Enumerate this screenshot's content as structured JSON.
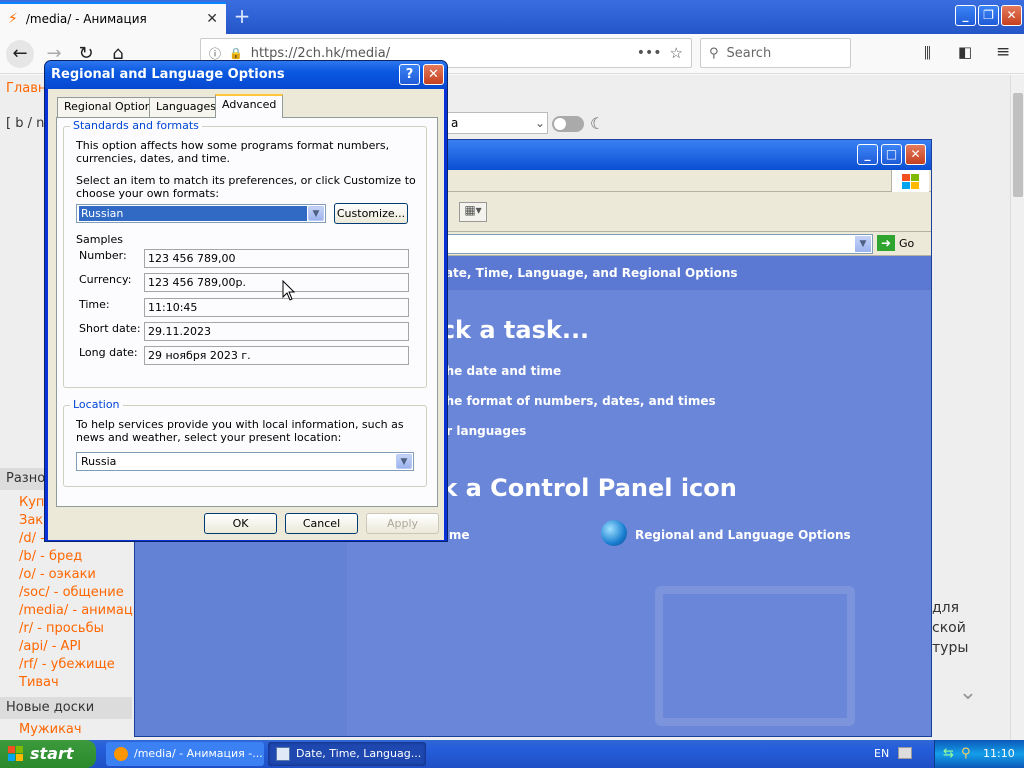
{
  "browser": {
    "tab_title": "/media/ - Анимация",
    "url": "https://2ch.hk/media/",
    "search_placeholder": "Search"
  },
  "page": {
    "menu_title": "Главная",
    "board_nav": "[ b / n",
    "theme_value": "a",
    "section_misc": "Разное",
    "misc_links": [
      "Купить",
      "Заказать",
      "/d/ - ...",
      "/b/ - бред",
      "/o/ - оэкаки",
      "/soc/ - общение",
      "/media/ - анимация",
      "/r/ - просьбы",
      "/api/ - API",
      "/rf/ - убежище",
      "Тивач"
    ],
    "section_new": "Новые доски",
    "new_link": "Мужикач",
    "right_text": [
      "для",
      "ской",
      "туры"
    ]
  },
  "control_panel": {
    "header": "Date, Time, Language, and Regional Options",
    "pick_task": "Pick a task...",
    "tasks": [
      "Change the date and time",
      "Change the format of numbers, dates, and times",
      "Add other languages"
    ],
    "pick_icon": "or pick a Control Panel icon",
    "icons": [
      "Date and Time",
      "Regional and Language Options"
    ],
    "go_label": "Go"
  },
  "dialog": {
    "title": "Regional and Language Options",
    "tabs": [
      "Regional Options",
      "Languages",
      "Advanced"
    ],
    "standards_title": "Standards and formats",
    "standards_desc": "This option affects how some programs format numbers, currencies, dates, and time.",
    "select_desc": "Select an item to match its preferences, or click Customize to choose your own formats:",
    "format_value": "Russian",
    "customize_label": "Customize...",
    "samples_title": "Samples",
    "samples": [
      {
        "label": "Number:",
        "value": "123 456 789,00"
      },
      {
        "label": "Currency:",
        "value": "123 456 789,00р."
      },
      {
        "label": "Time:",
        "value": "11:10:45"
      },
      {
        "label": "Short date:",
        "value": "29.11.2023"
      },
      {
        "label": "Long date:",
        "value": "29 ноября 2023 г."
      }
    ],
    "location_title": "Location",
    "location_desc": "To help services provide you with local information, such as news and weather, select your present location:",
    "location_value": "Russia",
    "ok_label": "OK",
    "cancel_label": "Cancel",
    "apply_label": "Apply"
  },
  "taskbar": {
    "start_label": "start",
    "task1": "/media/ - Анимация -...",
    "task2": "Date, Time, Languag...",
    "lang": "EN",
    "clock": "11:10"
  }
}
